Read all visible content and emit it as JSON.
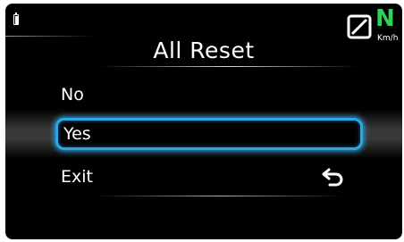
{
  "status": {
    "battery_icon": "battery-icon",
    "gear": "N",
    "gear_color": "#2fd15c",
    "speed_unit": "Km/h",
    "speed_icon": "zero-speed-icon"
  },
  "header": {
    "title": "All Reset"
  },
  "menu": {
    "items": [
      {
        "label": "No",
        "selected": false
      },
      {
        "label": "Yes",
        "selected": true
      },
      {
        "label": "Exit",
        "selected": false,
        "icon": "back-arrow-icon"
      }
    ],
    "highlight_color": "#2aa7e6"
  }
}
